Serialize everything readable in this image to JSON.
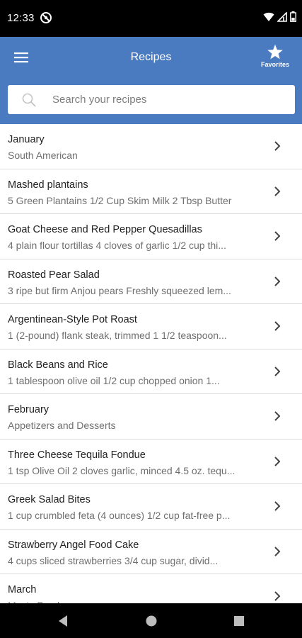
{
  "status_bar": {
    "time": "12:33",
    "icons": [
      "app-notification-icon",
      "wifi-icon",
      "cell-signal-icon",
      "battery-icon"
    ]
  },
  "app_bar": {
    "title": "Recipes",
    "menu_icon": "hamburger-menu-icon",
    "favorites_label": "Favorites",
    "favorites_icon": "star-icon",
    "color": "#4a7bc0"
  },
  "search": {
    "placeholder": "Search your recipes",
    "value": ""
  },
  "recipes": [
    {
      "title": "January",
      "subtitle": "South American"
    },
    {
      "title": "Mashed plantains",
      "subtitle": "5 Green Plantains 1/2 Cup Skim Milk 2 Tbsp Butter"
    },
    {
      "title": "Goat Cheese and Red Pepper Quesadillas",
      "subtitle": "4 plain flour tortillas 4 cloves of garlic 1/2 cup thi..."
    },
    {
      "title": "Roasted Pear Salad",
      "subtitle": "3 ripe but firm Anjou pears  Freshly squeezed lem..."
    },
    {
      "title": "Argentinean-Style Pot Roast",
      "subtitle": "1  (2-pound) flank steak, trimmed 1 1/2  teaspoon..."
    },
    {
      "title": "Black Beans and Rice",
      "subtitle": "1  tablespoon  olive oil 1/2  cup  chopped onion 1..."
    },
    {
      "title": "February",
      "subtitle": "Appetizers and Desserts"
    },
    {
      "title": "Three Cheese Tequila Fondue",
      "subtitle": "1 tsp Olive Oil 2 cloves garlic, minced 4.5 oz. tequ..."
    },
    {
      "title": "Greek Salad Bites",
      "subtitle": "1 cup crumbled feta (4 ounces) 1/2 cup fat-free p..."
    },
    {
      "title": "Strawberry Angel Food Cake",
      "subtitle": "4  cups  sliced strawberries 3/4  cup  sugar, divid..."
    },
    {
      "title": "March",
      "subtitle": "Movie Food"
    }
  ],
  "nav_bar": {
    "icons": [
      "back-icon",
      "home-icon",
      "recents-icon"
    ]
  }
}
